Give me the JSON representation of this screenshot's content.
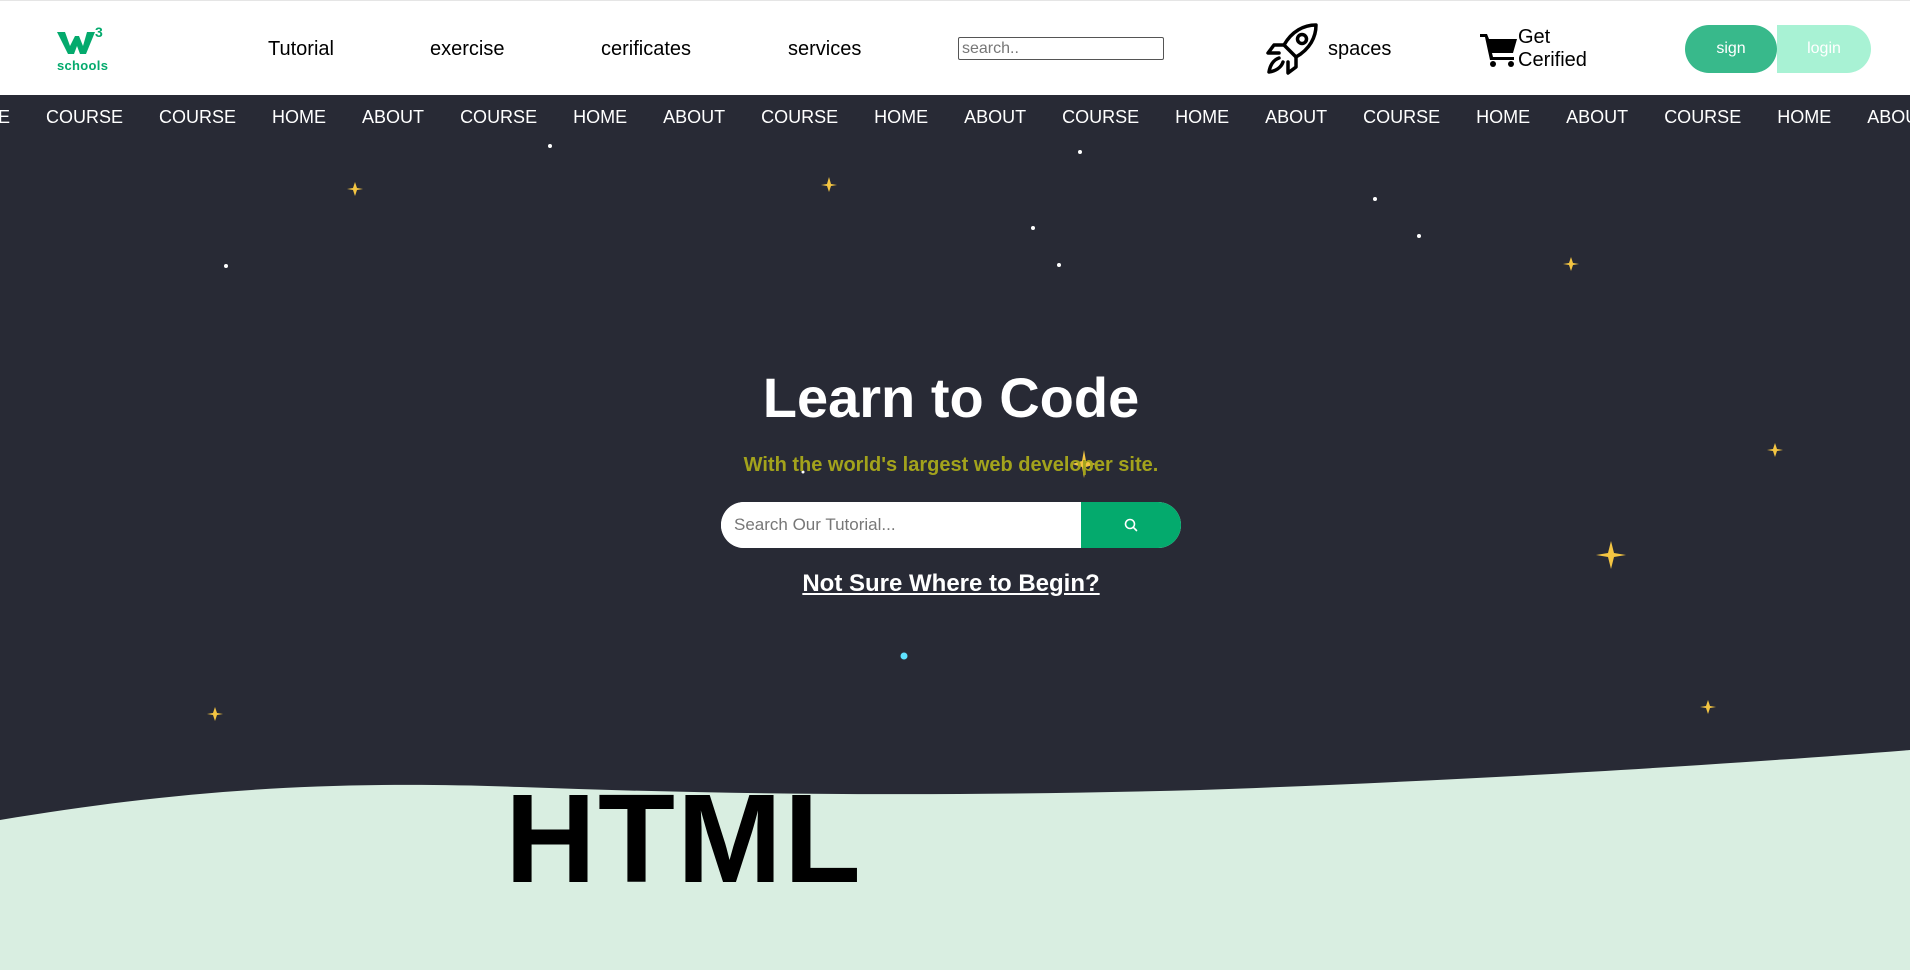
{
  "brand": {
    "logo_superscript": "3",
    "logo_text": "schools",
    "accent": "#04aa6d"
  },
  "nav": {
    "tutorial": "Tutorial",
    "exercise": "exercise",
    "certificates": "cerificates",
    "services": "services",
    "search_placeholder": "search..",
    "spaces": "spaces",
    "get_certified": "Get Cerified",
    "sign": "sign",
    "login": "login"
  },
  "marquee": {
    "leading_fragment": "SE",
    "items": [
      "COURSE",
      "COURSE",
      "HOME",
      "ABOUT",
      "COURSE",
      "HOME",
      "ABOUT",
      "COURSE",
      "HOME",
      "ABOUT",
      "COURSE",
      "HOME",
      "ABOUT",
      "COURSE",
      "HOME",
      "ABOUT",
      "COURSE",
      "HOME",
      "ABOUT"
    ]
  },
  "hero": {
    "title": "Learn to Code",
    "subtitle": "With the world's largest web developer site.",
    "search_placeholder": "Search Our Tutorial...",
    "begin_link": "Not Sure Where to Begin?",
    "background": "#282a35",
    "subtitle_color": "#a3a31c"
  },
  "section": {
    "heading": "HTML",
    "background": "#d9eee1"
  }
}
